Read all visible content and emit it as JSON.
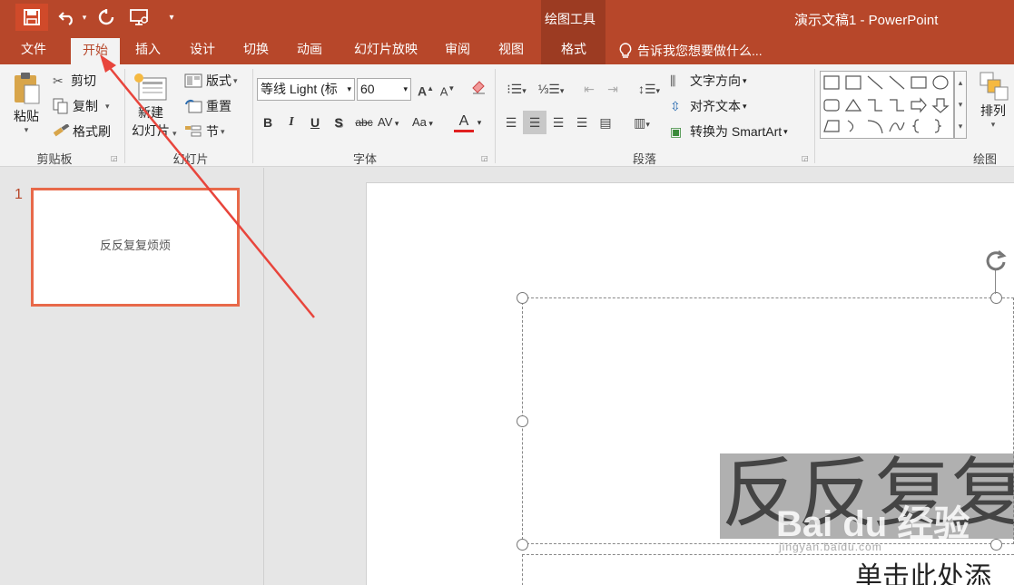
{
  "window": {
    "title": "演示文稿1 - PowerPoint",
    "contextual_tab_group": "绘图工具"
  },
  "tabs": [
    "文件",
    "开始",
    "插入",
    "设计",
    "切换",
    "动画",
    "幻灯片放映",
    "审阅",
    "视图",
    "格式"
  ],
  "tell_me": "告诉我您想要做什么...",
  "clipboard": {
    "paste": "粘贴",
    "cut": "剪切",
    "copy": "复制",
    "format_painter": "格式刷",
    "label": "剪贴板"
  },
  "slides": {
    "new_line1": "新建",
    "new_line2": "幻灯片",
    "layout": "版式",
    "reset": "重置",
    "section": "节",
    "label": "幻灯片"
  },
  "font": {
    "name": "等线 Light (标",
    "size": "60",
    "label": "字体",
    "bold": "B",
    "italic": "I",
    "underline": "U",
    "shadow": "S",
    "strike": "abc",
    "spacing": "AV",
    "case": "Aa",
    "color": "A"
  },
  "paragraph": {
    "text_direction": "文字方向",
    "align_text": "对齐文本",
    "smartart": "转换为 SmartArt",
    "label": "段落"
  },
  "drawing": {
    "arrange": "排列",
    "label": "绘图"
  },
  "thumbnail": {
    "number": "1",
    "text": "反反复复烦烦"
  },
  "slide": {
    "title_text": "反反复复",
    "subtitle_placeholder": "单击此处添",
    "watermark": "Bai du 经验",
    "watermark_url": "jingyan.baidu.com"
  },
  "colors": {
    "accent": "#b7472a",
    "thumb_border": "#e8694a",
    "annotation_arrow": "#e8453c"
  }
}
